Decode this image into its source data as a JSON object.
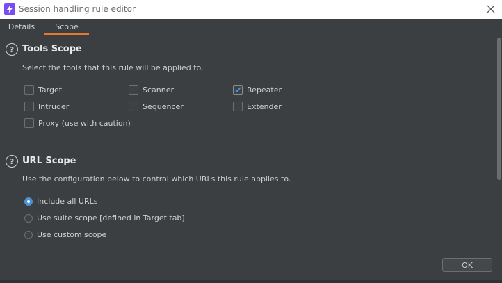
{
  "window": {
    "title": "Session handling rule editor",
    "icon": "lightning-icon",
    "accent_color": "#e8772e",
    "brand_color": "#7a4df0"
  },
  "tabs": [
    {
      "label": "Details",
      "active": false
    },
    {
      "label": "Scope",
      "active": true
    }
  ],
  "tools_scope": {
    "title": "Tools Scope",
    "description": "Select the tools that this rule will be applied to.",
    "tools": [
      {
        "label": "Target",
        "checked": false
      },
      {
        "label": "Scanner",
        "checked": false
      },
      {
        "label": "Repeater",
        "checked": true
      },
      {
        "label": "Intruder",
        "checked": false
      },
      {
        "label": "Sequencer",
        "checked": false
      },
      {
        "label": "Extender",
        "checked": false
      },
      {
        "label": "Proxy (use with caution)",
        "checked": false
      }
    ]
  },
  "url_scope": {
    "title": "URL Scope",
    "description": "Use the configuration below to control which URLs this rule applies to.",
    "options": [
      {
        "label": "Include all URLs",
        "selected": true
      },
      {
        "label": "Use suite scope [defined in Target tab]",
        "selected": false
      },
      {
        "label": "Use custom scope",
        "selected": false
      }
    ]
  },
  "footer": {
    "ok_label": "OK"
  }
}
